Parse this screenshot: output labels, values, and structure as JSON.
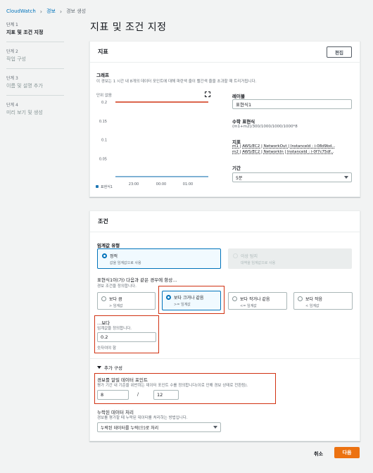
{
  "breadcrumb": {
    "root": "CloudWatch",
    "mid": "경보",
    "current": "경보 생성"
  },
  "steps": [
    {
      "num": "단계 1",
      "label": "지표 및 조건 지정"
    },
    {
      "num": "단계 2",
      "label": "작업 구성"
    },
    {
      "num": "단계 3",
      "label": "이름 및 설명 추가"
    },
    {
      "num": "단계 4",
      "label": "미리 보기 및 생성"
    }
  ],
  "page_title": "지표 및 조건 지정",
  "metric": {
    "header": "지표",
    "edit_label": "편집",
    "graph_title": "그래프",
    "graph_desc": "이 경보는 1 시간 내 8개의 데이터 포인트에 대해 파란색 줄이 빨간색 줄을 초과할 때 트리거됩니다.",
    "unit_label": "단위 없음",
    "legend": "표현식1",
    "label_title": "레이블",
    "label_value": "표현식1",
    "math_title": "수학 표현식",
    "math_value": "(m1+m2)/300/1000/1000/1000*8",
    "metric_title": "지표",
    "metric_line1": "m1 | AWS/EC2 | NetworkOut | InstanceId : i-08d9bd...",
    "metric_line2": "m2 | AWS/EC2 | NetworkIn | InstanceId : i-0f7c75df...",
    "period_title": "기간",
    "period_value": "5분"
  },
  "chart_data": {
    "type": "line",
    "ylabel": "단위 없음",
    "y_ticks": [
      "0.2",
      "0.15",
      "0.1",
      "0.05"
    ],
    "x_ticks": [
      "23:00",
      "00:00",
      "01:00"
    ],
    "ylim": [
      0,
      0.2
    ],
    "series": [
      {
        "name": "표현식1",
        "color": "#1f77b4",
        "values": [
          0.002,
          0.002,
          0.002,
          0.002
        ]
      },
      {
        "name": "threshold",
        "color": "#d13212",
        "values": [
          0.2,
          0.2,
          0.2,
          0.2
        ]
      }
    ],
    "legend": "bottom-left",
    "grid": false
  },
  "conditions": {
    "header": "조건",
    "threshold_type_label": "임계값 유형",
    "static_title": "정적",
    "static_desc": "값을 임계값으로 사용",
    "anomaly_title": "이상 탐지",
    "anomaly_desc": "대역을 임계값으로 사용",
    "whenever_label": "표현식1이(가) 다음과 같은 경우에 항상...",
    "whenever_desc": "경보 조건을 정의합니다.",
    "options": [
      {
        "title": "보다 큼",
        "desc": "> 임계값"
      },
      {
        "title": "보다 크거나 같음",
        "desc": ">= 임계값"
      },
      {
        "title": "보다 작거나 같음",
        "desc": "<= 임계값"
      },
      {
        "title": "보다 작음",
        "desc": "< 임계값"
      }
    ],
    "than_label": "...보다",
    "than_desc": "임계값을 정의합니다.",
    "than_value": "0.2",
    "than_hint": "숫자여야 함",
    "additional_label": "추가 구성",
    "datapoints_label": "경보를 알릴 데이터 포인트",
    "datapoints_desc": "평가 기간 내 기준을 위반하는 데이터 포인트 수를 정의합니다(이로 인해 경보 상태로 전환됨).",
    "datapoints_value": "8",
    "datapoints_sep": "/",
    "evaluation_value": "12",
    "missing_label": "누락된 데이터 처리",
    "missing_desc": "경보를 평가할 때 누락된 데이터를 처리하는 방법입니다.",
    "missing_value": "누락된 데이터를 누락(으)로 처리"
  },
  "footer": {
    "cancel": "취소",
    "next": "다음"
  }
}
